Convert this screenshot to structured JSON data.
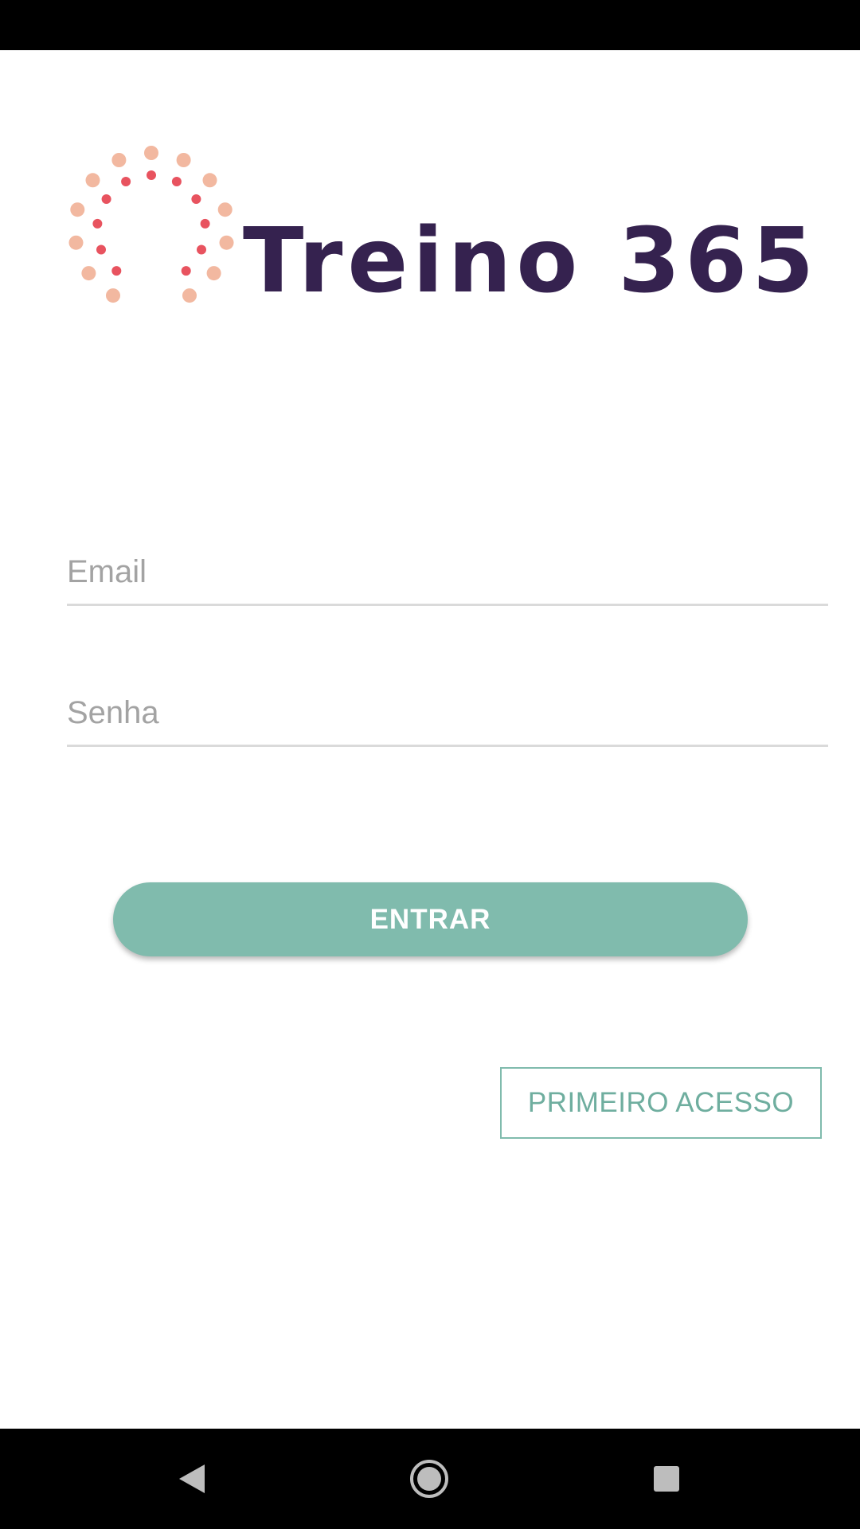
{
  "app": {
    "logo_text": "Treino 365",
    "brand_color": "#35224f",
    "accent_color": "#80bbad",
    "dot_colors": {
      "outer": "#f2b8a0",
      "inner": "#e8535f"
    }
  },
  "form": {
    "email": {
      "placeholder": "Email",
      "value": ""
    },
    "password": {
      "placeholder": "Senha",
      "value": ""
    },
    "login_label": "ENTRAR",
    "first_access_label": "PRIMEIRO ACESSO"
  },
  "system_nav": {
    "back_icon": "back-triangle-icon",
    "home_icon": "home-circle-icon",
    "recents_icon": "recents-square-icon"
  }
}
